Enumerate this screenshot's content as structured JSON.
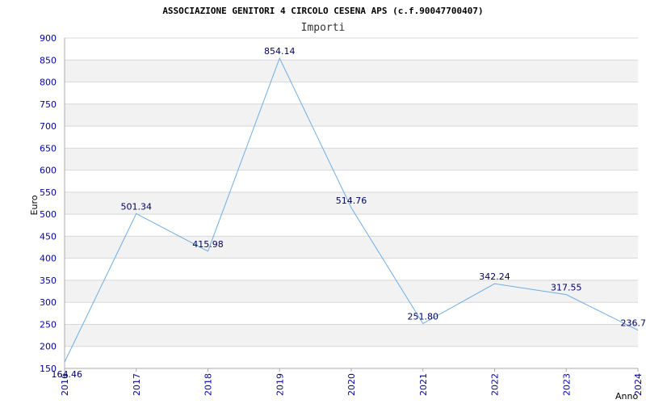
{
  "chart_data": {
    "type": "line",
    "title": "ASSOCIAZIONE GENITORI 4 CIRCOLO CESENA APS (c.f.90047700407)",
    "subtitle": "Importi",
    "xlabel": "Anno",
    "ylabel": "Euro",
    "x": [
      "2016",
      "2017",
      "2018",
      "2019",
      "2020",
      "2021",
      "2022",
      "2023",
      "2024"
    ],
    "values": [
      164.46,
      501.34,
      415.98,
      854.14,
      514.76,
      251.8,
      342.24,
      317.55,
      236.7
    ],
    "data_labels": [
      "164.46",
      "501.34",
      "415.98",
      "854.14",
      "514.76",
      "251.80",
      "342.24",
      "317.55",
      "236.7"
    ],
    "y_ticks": [
      "150",
      "200",
      "250",
      "300",
      "350",
      "400",
      "450",
      "500",
      "550",
      "600",
      "650",
      "700",
      "750",
      "800",
      "850",
      "900"
    ],
    "ylim": [
      150,
      900
    ],
    "grid": true,
    "legend": "none",
    "colors": {
      "line": "#6aaee8",
      "band": "#f2f2f2",
      "gridline": "#d8d8d8",
      "axis": "#aaaaaa",
      "tick_text": "#0000aa",
      "label_text": "#000066"
    }
  }
}
